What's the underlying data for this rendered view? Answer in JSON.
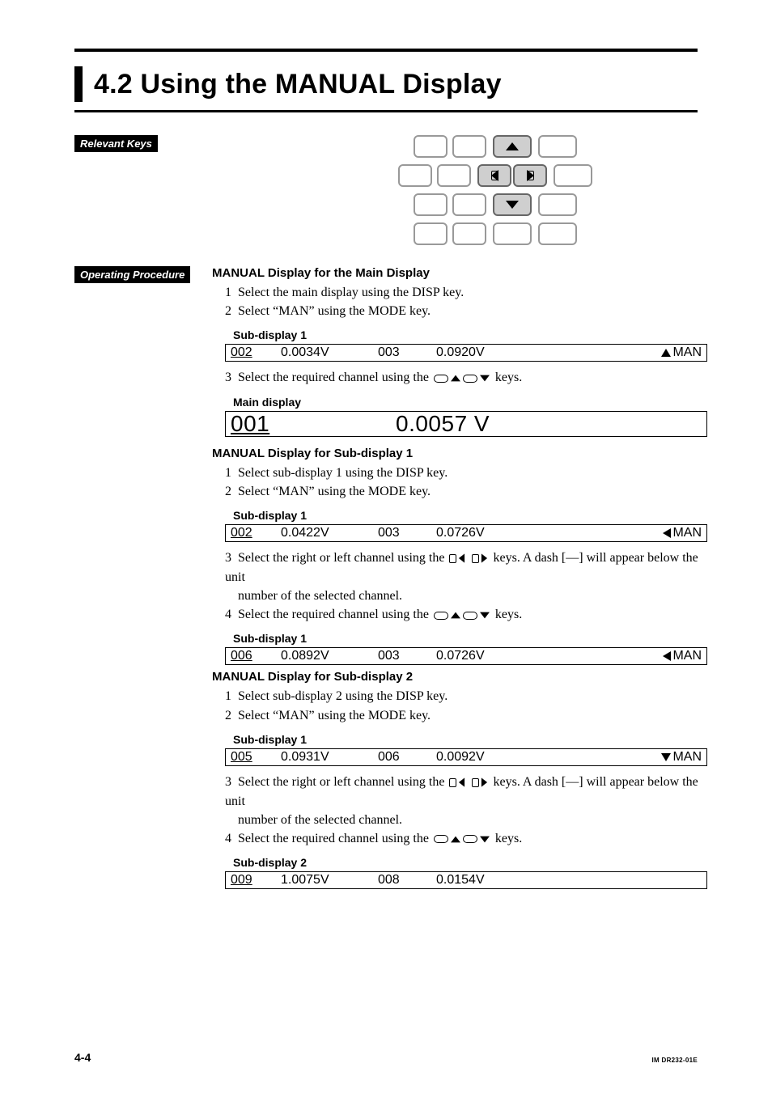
{
  "title": "4.2   Using the MANUAL Display",
  "tags": {
    "relevant_keys": "Relevant Keys",
    "operating_procedure": "Operating Procedure"
  },
  "procedure": {
    "mainHeading": "MANUAL Display for the Main Display",
    "mainSteps": [
      "Select the main display using the DISP key.",
      "Select “MAN” using the MODE key."
    ],
    "mainStep3a": "Select the required channel using the ",
    "mainStep3b": " keys.",
    "sub1AHeading": "MANUAL Display for Sub-display 1",
    "sub1ASteps": [
      "Select sub-display 1 using the DISP key.",
      "Select “MAN” using the MODE key."
    ],
    "sub1Step3a": "Select the right or left channel using the ",
    "sub1Step3b": " keys. A dash [—] will appear below the unit",
    "sub1Step3c": "number of the selected channel.",
    "sub1Step4a": "Select the required channel using the ",
    "sub1Step4b": " keys.",
    "sub2Heading": "MANUAL Display for Sub-display 2",
    "sub2Steps": [
      "Select sub-display 2 using the DISP key.",
      "Select “MAN” using the MODE key."
    ]
  },
  "labels": {
    "sub1": "Sub-display 1",
    "main": "Main display",
    "sub2": "Sub-display 2",
    "man": "MAN"
  },
  "displays": {
    "d1": {
      "ch1": "002",
      "v1": "0.0034V",
      "ch2": "003",
      "v2": "0.0920V",
      "arrow": "up"
    },
    "main": {
      "ch": "001",
      "v": "0.0057 V"
    },
    "d2": {
      "ch1": "002",
      "v1": "0.0422V",
      "ch2": "003",
      "v2": "0.0726V",
      "arrow": "left"
    },
    "d3": {
      "ch1": "006",
      "v1": "0.0892V",
      "ch2": "003",
      "v2": "0.0726V",
      "arrow": "left"
    },
    "d4": {
      "ch1": "005",
      "v1": "0.0931V",
      "ch2": "006",
      "v2": "0.0092V",
      "arrow": "down"
    },
    "d5": {
      "ch1": "009",
      "v1": "1.0075V",
      "ch2": "008",
      "v2": "0.0154V"
    }
  },
  "nums": {
    "n1": "1",
    "n2": "2",
    "n3": "3",
    "n4": "4"
  },
  "footer": {
    "page": "4-4",
    "doc": "IM DR232-01E"
  }
}
